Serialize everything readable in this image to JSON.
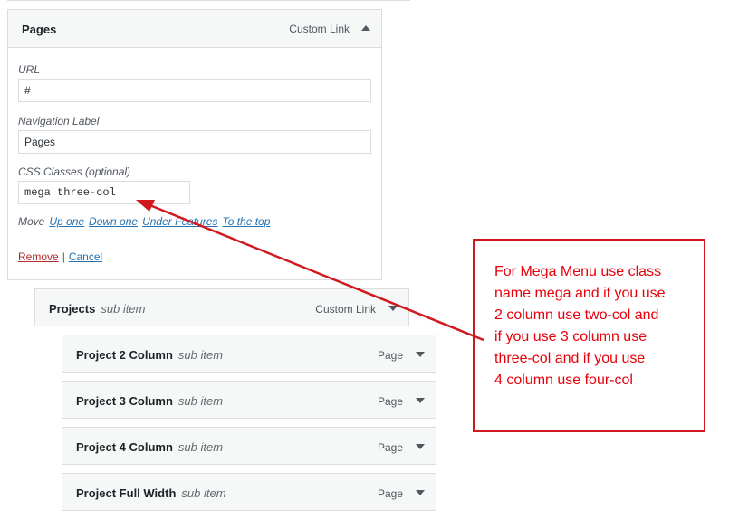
{
  "pages_item": {
    "title": "Pages",
    "type": "Custom Link",
    "url_label": "URL",
    "url_value": "#",
    "nav_label": "Navigation Label",
    "nav_value": "Pages",
    "css_label": "CSS Classes (optional)",
    "css_value": "mega three-col",
    "move_label": "Move",
    "move_links": [
      "Up one",
      "Down one",
      "Under Features",
      "To the top"
    ],
    "remove_label": "Remove",
    "separator": "|",
    "cancel_label": "Cancel"
  },
  "projects_item": {
    "title": "Projects",
    "subtitle": "sub item",
    "type": "Custom Link"
  },
  "sub_items": [
    {
      "title": "Project 2 Column",
      "subtitle": "sub item",
      "type": "Page"
    },
    {
      "title": "Project 3 Column",
      "subtitle": "sub item",
      "type": "Page"
    },
    {
      "title": "Project 4 Column",
      "subtitle": "sub item",
      "type": "Page"
    },
    {
      "title": "Project Full Width",
      "subtitle": "sub item",
      "type": "Page"
    }
  ],
  "callout": {
    "text": "For Mega Menu use class\nname mega and if you use\n2 column use two-col and\nif you use 3 column use\nthree-col and if you use\n4 column use four-col"
  },
  "colors": {
    "annotation_red": "#e8000b",
    "link_blue": "#2271b1",
    "remove_red": "#b32d2e"
  }
}
